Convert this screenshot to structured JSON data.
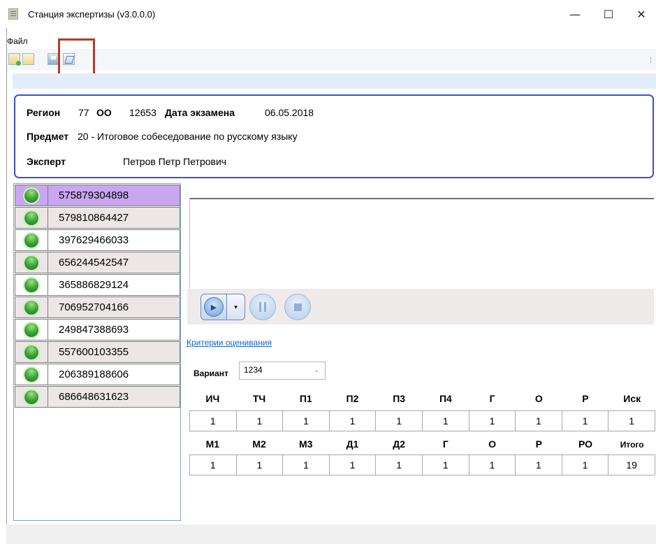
{
  "window": {
    "title": "Станция экспертизы (v3.0.0.0)",
    "minimize_icon": "—",
    "maximize_icon": "☐",
    "close_icon": "✕"
  },
  "menu": {
    "file": "Файл"
  },
  "toolbar": {
    "icons": [
      "open-folder-icon",
      "folder-icon",
      "save-icon",
      "edit-icon"
    ]
  },
  "header": {
    "region_label": "Регион",
    "region_value": "77",
    "oo_label": "ОО",
    "oo_value": "12653",
    "exam_date_label": "Дата экзамена",
    "exam_date_value": "06.05.2018",
    "subject_label": "Предмет",
    "subject_value": "20 - Итоговое собеседование по русскому языку",
    "expert_label": "Эксперт",
    "expert_value": "Петров Петр Петрович"
  },
  "works": [
    {
      "code": "575879304898",
      "status": "green"
    },
    {
      "code": "579810864427",
      "status": "green"
    },
    {
      "code": "397629466033",
      "status": "green"
    },
    {
      "code": "656244542547",
      "status": "green"
    },
    {
      "code": "365886829124",
      "status": "green"
    },
    {
      "code": "706952704166",
      "status": "green"
    },
    {
      "code": "249847388693",
      "status": "green"
    },
    {
      "code": "557600103355",
      "status": "green"
    },
    {
      "code": "206389188606",
      "status": "green"
    },
    {
      "code": "686648631623",
      "status": "green"
    }
  ],
  "player": {
    "play_icon": "▶",
    "dropdown_icon": "▾"
  },
  "criteria_link": "Критерии оценивания",
  "variant": {
    "label": "Вариант",
    "value": "1234",
    "chevron": "⌄"
  },
  "scores": {
    "row1_headers": [
      "ИЧ",
      "ТЧ",
      "П1",
      "П2",
      "П3",
      "П4",
      "Г",
      "О",
      "Р",
      "Иск"
    ],
    "row1_values": [
      "1",
      "1",
      "1",
      "1",
      "1",
      "1",
      "1",
      "1",
      "1",
      "1"
    ],
    "row2_headers": [
      "М1",
      "М2",
      "М3",
      "Д1",
      "Д2",
      "Г",
      "О",
      "Р",
      "РО",
      "Итого"
    ],
    "row2_values": [
      "1",
      "1",
      "1",
      "1",
      "1",
      "1",
      "1",
      "1",
      "1",
      "19"
    ]
  },
  "colors": {
    "header_border": "#3d4fd0",
    "selected_row": "#c9a6f0",
    "highlight_box": "#b53a2a",
    "link": "#1a63c8"
  }
}
